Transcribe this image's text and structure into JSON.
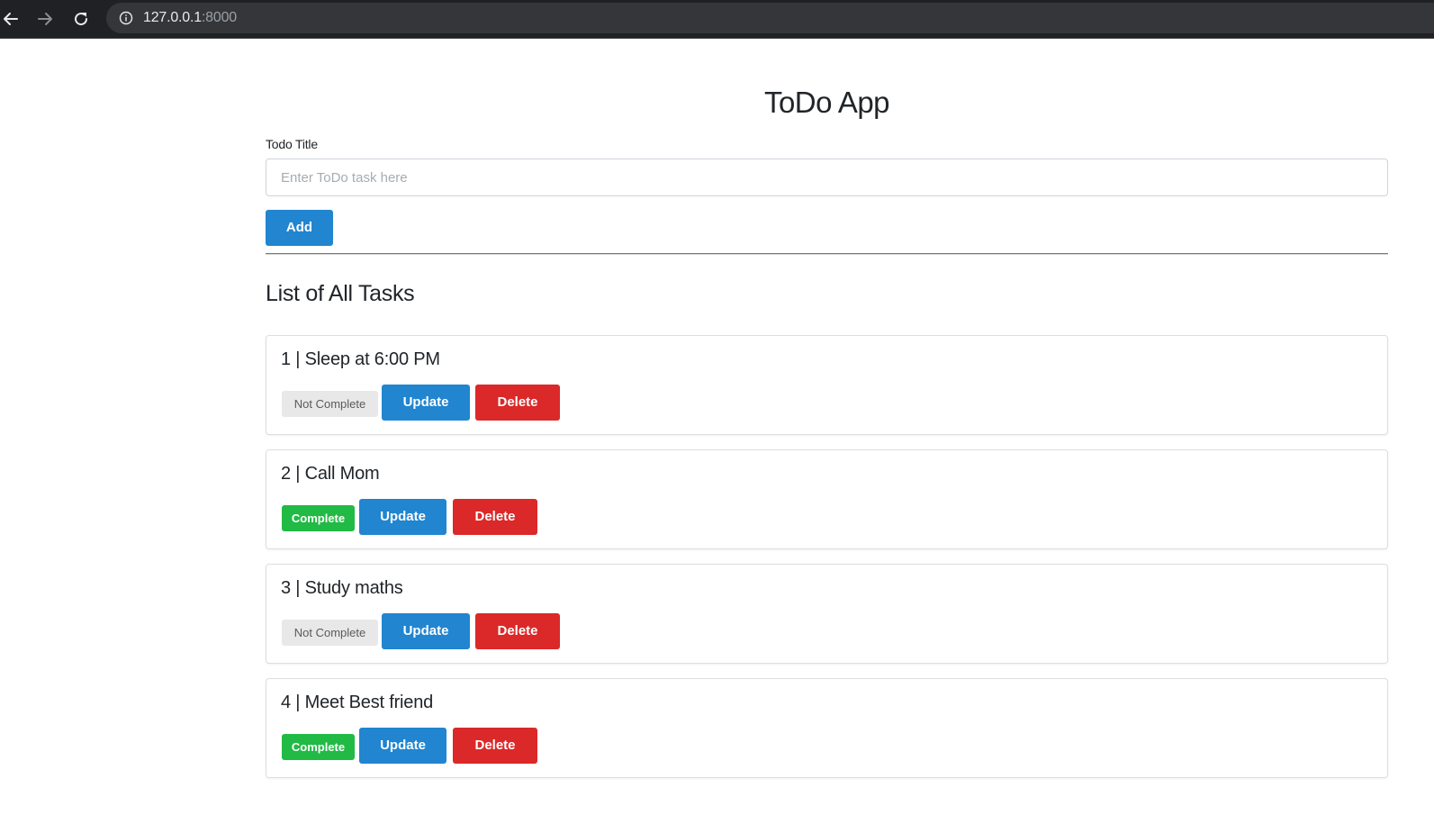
{
  "browser": {
    "url_host": "127.0.0.1",
    "url_port": ":8000"
  },
  "app": {
    "title": "ToDo App",
    "field_label": "Todo Title",
    "input_placeholder": "Enter ToDo task here",
    "input_value": "",
    "add_label": "Add",
    "list_heading": "List of All Tasks"
  },
  "tasks": [
    {
      "title": "1 | Sleep at 6:00 PM",
      "status": "Not Complete",
      "complete": false,
      "update_label": "Update",
      "delete_label": "Delete"
    },
    {
      "title": "2 | Call Mom",
      "status": "Complete",
      "complete": true,
      "update_label": "Update",
      "delete_label": "Delete"
    },
    {
      "title": "3 | Study maths",
      "status": "Not Complete",
      "complete": false,
      "update_label": "Update",
      "delete_label": "Delete"
    },
    {
      "title": "4 | Meet Best friend",
      "status": "Complete",
      "complete": true,
      "update_label": "Update",
      "delete_label": "Delete"
    }
  ],
  "colors": {
    "primary": "#2185d0",
    "danger": "#db2828",
    "complete": "#21ba45",
    "incomplete": "#e8e8e8"
  }
}
